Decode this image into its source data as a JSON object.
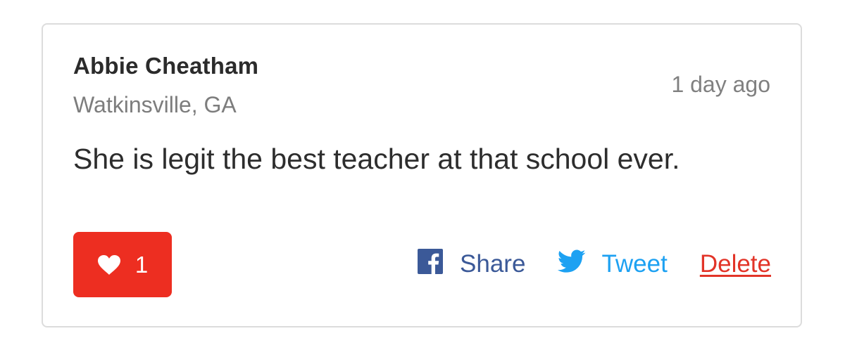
{
  "comment": {
    "author": "Abbie Cheatham",
    "location": "Watkinsville, GA",
    "timestamp": "1 day ago",
    "text": "She is legit the best teacher at that school ever.",
    "likes": "1"
  },
  "actions": {
    "share_label": "Share",
    "tweet_label": "Tweet",
    "delete_label": "Delete"
  },
  "icons": {
    "like": "heart-icon",
    "share": "facebook-icon",
    "tweet": "twitter-icon"
  },
  "colors": {
    "like_bg": "#ed2e21",
    "facebook": "#3b5998",
    "twitter": "#1da1f2",
    "delete": "#e23428"
  }
}
